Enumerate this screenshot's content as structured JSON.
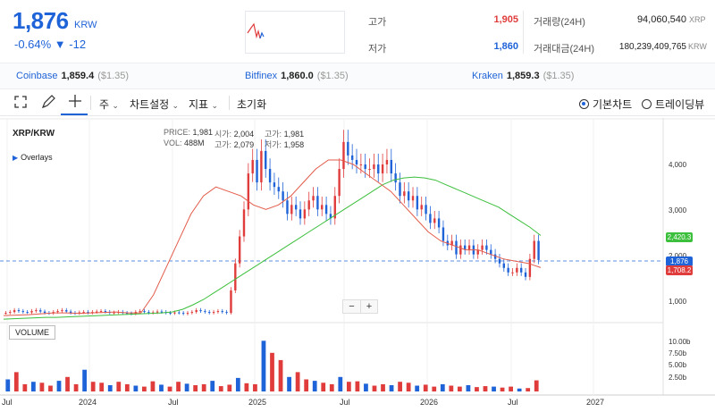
{
  "header": {
    "price": "1,876",
    "unit": "KRW",
    "change": "-0.64% ▼ -12",
    "high_label": "고가",
    "high_value": "1,905",
    "low_label": "저가",
    "low_value": "1,860",
    "volume_label": "거래량(24H)",
    "volume_value": "94,060,540",
    "volume_unit": "XRP",
    "amount_label": "거래대금(24H)",
    "amount_value": "180,239,409,765",
    "amount_unit": "KRW"
  },
  "exchanges": [
    {
      "name": "Coinbase",
      "price": "1,859.4",
      "usd": "($1.35)"
    },
    {
      "name": "Bitfinex",
      "price": "1,860.0",
      "usd": "($1.35)"
    },
    {
      "name": "Kraken",
      "price": "1,859.3",
      "usd": "($1.35)"
    }
  ],
  "toolbar": {
    "period": "주",
    "chart_settings": "차트설정",
    "indicators": "지표",
    "reset": "초기화",
    "basic_chart": "기본차트",
    "trading_view": "트레이딩뷰"
  },
  "chart": {
    "pair": "XRP/KRW",
    "overlays": "Overlays",
    "volume_label": "VOLUME",
    "legend": {
      "price_k": "PRICE:",
      "price_v": "1,981",
      "open_k": "시가:",
      "open_v": "2,004",
      "high_k": "고가:",
      "high_v": "1,981",
      "vol_k": "VOL:",
      "vol_v": "488M",
      "high2_k": "고가:",
      "high2_v": "2,079",
      "low_k": "저가:",
      "low_v": "1,958"
    },
    "zoom_minus": "−",
    "zoom_plus": "+",
    "y_labels": [
      "4,000",
      "3,000",
      "2,000",
      "1,000"
    ],
    "vol_labels": [
      "10.00b",
      "7.50b",
      "5.00b",
      "2.50b"
    ],
    "x_labels": [
      "Jul",
      "2024",
      "Jul",
      "2025",
      "Jul",
      "2026",
      "Jul",
      "2027"
    ],
    "tags": {
      "green": "2,420.3",
      "blue": "1,876",
      "red": "1,708.2"
    }
  },
  "colors": {
    "accent": "#1f63d8",
    "up": "#e03c3c",
    "down": "#1f63d8",
    "ma_long": "#3cbf3c",
    "ma_short": "#e35b4a"
  },
  "chart_data": {
    "type": "candlestick",
    "x_labels": [
      "Jul",
      "2024",
      "Jul",
      "2025",
      "Jul",
      "2026",
      "Jul",
      "2027"
    ],
    "y_ticks": [
      1000,
      2000,
      3000,
      4000
    ],
    "price_series_close": [
      700,
      720,
      760,
      740,
      720,
      710,
      740,
      760,
      730,
      700,
      690,
      720,
      740,
      760,
      730,
      700,
      690,
      710,
      720,
      700,
      720,
      730,
      740,
      720,
      700,
      710,
      720,
      700,
      690,
      680,
      720,
      740,
      720,
      700,
      710,
      730,
      720,
      700,
      690,
      710,
      700,
      680,
      700,
      720,
      760,
      740,
      720,
      700,
      720,
      740,
      720,
      700,
      1200,
      1800,
      2400,
      3000,
      3800,
      4100,
      3600,
      4300,
      3900,
      3600,
      3500,
      3400,
      3200,
      2900,
      3100,
      3000,
      2800,
      3000,
      3200,
      3300,
      3000,
      3100,
      2900,
      2800,
      3300,
      3900,
      4500,
      4200,
      4100,
      4000,
      4000,
      3900,
      3900,
      4000,
      3800,
      4000,
      4100,
      3800,
      3600,
      3300,
      3400,
      3200,
      3300,
      3000,
      3100,
      2900,
      2700,
      2800,
      2600,
      2300,
      2200,
      2300,
      2000,
      2200,
      2100,
      2200,
      2000,
      2100,
      2200,
      2100,
      2000,
      1900,
      1800,
      1700,
      1600,
      1600,
      1700,
      1600,
      1500,
      1900,
      2300,
      1876
    ],
    "ma_long": [
      560,
      570,
      580,
      590,
      600,
      600,
      610,
      620,
      630,
      640,
      650,
      660,
      670,
      680,
      690,
      700,
      720,
      780,
      880,
      1000,
      1150,
      1300,
      1450,
      1600,
      1750,
      1900,
      2050,
      2200,
      2350,
      2500,
      2650,
      2800,
      2950,
      3100,
      3250,
      3400,
      3550,
      3650,
      3700,
      3720,
      3700,
      3650,
      3550,
      3450,
      3350,
      3250,
      3150,
      3050,
      2900,
      2750,
      2600,
      2420
    ],
    "ma_short": [
      640,
      650,
      660,
      680,
      700,
      700,
      690,
      700,
      710,
      720,
      700,
      700,
      1100,
      1700,
      2300,
      2900,
      3300,
      3500,
      3400,
      3300,
      3100,
      3000,
      3100,
      3300,
      3600,
      3900,
      4100,
      4100,
      4000,
      3800,
      3600,
      3400,
      3100,
      2800,
      2500,
      2300,
      2200,
      2100,
      2100,
      2000,
      1900,
      1850,
      1800,
      1708
    ],
    "volume": [
      2.5,
      4,
      1.5,
      2,
      1.8,
      1.2,
      2.2,
      3,
      1.5,
      4.5,
      2,
      1.8,
      1.3,
      2,
      1.5,
      1.2,
      1,
      2.1,
      1.4,
      1,
      2,
      1.6,
      1.3,
      1.5,
      2.2,
      1.1,
      1.4,
      2.8,
      1.7,
      1.5,
      10.5,
      8,
      6.5,
      3,
      4,
      2.5,
      2.2,
      1.8,
      1.5,
      3,
      2,
      2.1,
      1.6,
      1.2,
      1.5,
      1.3,
      2,
      1.8,
      1.2,
      1.4,
      1,
      1.5,
      1.2,
      1,
      1.3,
      0.9,
      1.1,
      1,
      0.8,
      1,
      0.6,
      0.7,
      2.3
    ],
    "tags": [
      2420.3,
      1876,
      1708.2
    ]
  }
}
